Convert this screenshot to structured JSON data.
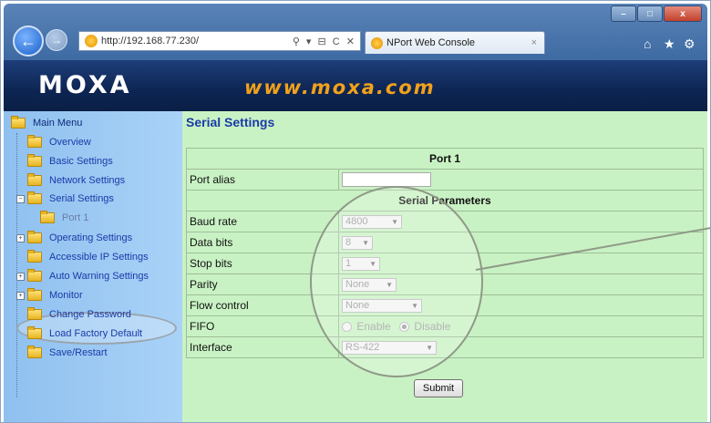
{
  "browser": {
    "address": "http://192.168.77.230/",
    "address_tools": "⚲ ▾ ⊟ C ✕",
    "tab_title": "NPort Web Console",
    "tab_close": "×",
    "win_min": "–",
    "win_max": "□",
    "win_close": "x",
    "back_glyph": "←",
    "forward_glyph": "→",
    "home_glyph": "⌂",
    "fav_glyph": "★",
    "settings_glyph": "⚙"
  },
  "banner": {
    "logo": "MOXA",
    "site": "www.moxa.com"
  },
  "sidebar": {
    "main_menu": "Main Menu",
    "items": [
      {
        "label": "Overview"
      },
      {
        "label": "Basic Settings"
      },
      {
        "label": "Network Settings"
      },
      {
        "label": "Serial Settings"
      },
      {
        "label": "Port 1"
      },
      {
        "label": "Operating Settings"
      },
      {
        "label": "Accessible IP Settings"
      },
      {
        "label": "Auto Warning Settings"
      },
      {
        "label": "Monitor"
      },
      {
        "label": "Change Password"
      },
      {
        "label": "Load Factory Default"
      },
      {
        "label": "Save/Restart"
      }
    ]
  },
  "main": {
    "title": "Serial Settings",
    "port_header": "Port 1",
    "port_alias_label": "Port alias",
    "port_alias_value": "",
    "serial_params_header": "Serial Parameters",
    "baud_rate": {
      "label": "Baud rate",
      "value": "4800"
    },
    "data_bits": {
      "label": "Data bits",
      "value": "8"
    },
    "stop_bits": {
      "label": "Stop bits",
      "value": "1"
    },
    "parity": {
      "label": "Parity",
      "value": "None"
    },
    "flow_control": {
      "label": "Flow control",
      "value": "None"
    },
    "fifo": {
      "label": "FIFO",
      "enable": "Enable",
      "disable": "Disable"
    },
    "interface": {
      "label": "Interface",
      "value": "RS-422"
    },
    "submit": "Submit"
  },
  "colors": {
    "content_bg": "#c9f2c4",
    "sidebar_bg": "#a9d2f7",
    "banner_bg": "#0d2553",
    "site_orange": "#f1a21a",
    "title_blue": "#1b3aa8"
  }
}
